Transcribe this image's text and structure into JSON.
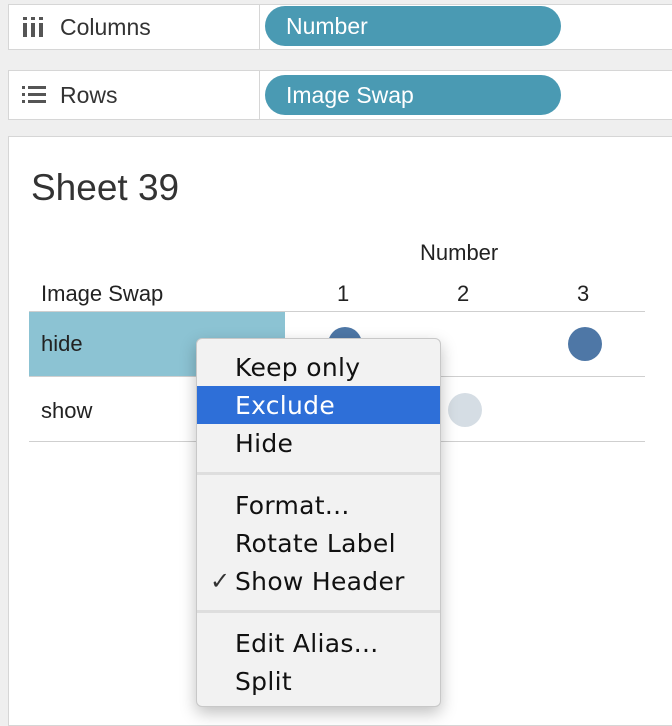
{
  "shelves": {
    "columns": {
      "label": "Columns",
      "pill": "Number"
    },
    "rows": {
      "label": "Rows",
      "pill": "Image Swap"
    }
  },
  "sheet": {
    "title": "Sheet 39",
    "column_field_header": "Number",
    "row_field_header": "Image Swap",
    "column_values": [
      "1",
      "2",
      "3"
    ],
    "row_values": [
      "hide",
      "show"
    ],
    "marks": {
      "hide": {
        "1": "filled",
        "3": "filled"
      },
      "show": {
        "2": "faded"
      }
    },
    "colors": {
      "mark": "#4e77a6",
      "mark_faded": "#d5dde4",
      "selected_row": "#8cc3d3",
      "pill": "#4a9ab3",
      "menu_highlight": "#2e6fd8"
    }
  },
  "context_menu": {
    "items": [
      {
        "label": "Keep only"
      },
      {
        "label": "Exclude",
        "highlighted": true
      },
      {
        "label": "Hide"
      },
      {
        "label": "Format..."
      },
      {
        "label": "Rotate Label"
      },
      {
        "label": "Show Header",
        "checked": true
      },
      {
        "label": "Edit Alias..."
      },
      {
        "label": "Split"
      }
    ],
    "check_glyph": "✓"
  }
}
